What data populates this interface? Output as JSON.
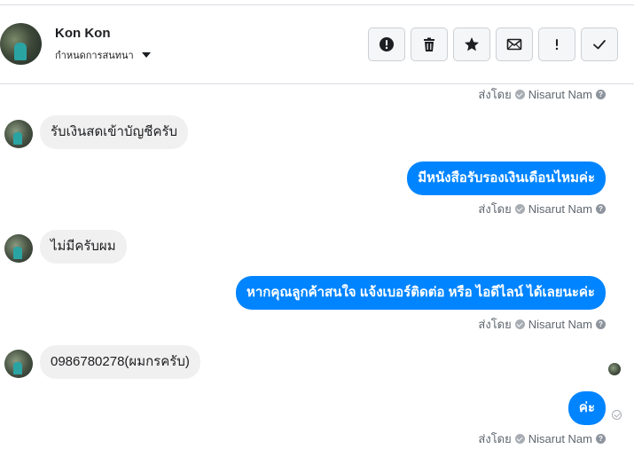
{
  "header": {
    "contact_name": "Kon Kon",
    "assign_label": "กำหนดการสนทนา",
    "actions": [
      {
        "name": "mark-spam-button",
        "icon": "alert-circle-icon"
      },
      {
        "name": "delete-button",
        "icon": "trash-icon"
      },
      {
        "name": "star-button",
        "icon": "star-icon"
      },
      {
        "name": "mark-unread-button",
        "icon": "envelope-icon"
      },
      {
        "name": "follow-up-button",
        "icon": "exclamation-icon"
      },
      {
        "name": "mark-done-button",
        "icon": "checkmark-icon"
      }
    ]
  },
  "thread": {
    "sent_by_prefix": "ส่งโดย",
    "sender_name": "Nisarut Nam",
    "help_glyph": "?",
    "messages": [
      {
        "direction": "in",
        "text": "รับเงินสดเข้าบัญชีครับ"
      },
      {
        "direction": "out",
        "text": "มีหนังสือรับรองเงินเดือนไหมค่ะ"
      },
      {
        "direction": "in",
        "text": "ไม่มีครับผม"
      },
      {
        "direction": "out",
        "text": "หากคุณลูกค้าสนใจ แจ้งเบอร์ติดต่อ หรือ ไอดีไลน์ ได้เลยนะค่ะ"
      },
      {
        "direction": "in",
        "text": "0986780278(ผมกรครับ)"
      },
      {
        "direction": "out",
        "text": "ค่ะ"
      }
    ]
  },
  "colors": {
    "outgoing_bubble": "#0084ff",
    "incoming_bubble": "#f1f0f0",
    "meta_text": "#606770"
  }
}
